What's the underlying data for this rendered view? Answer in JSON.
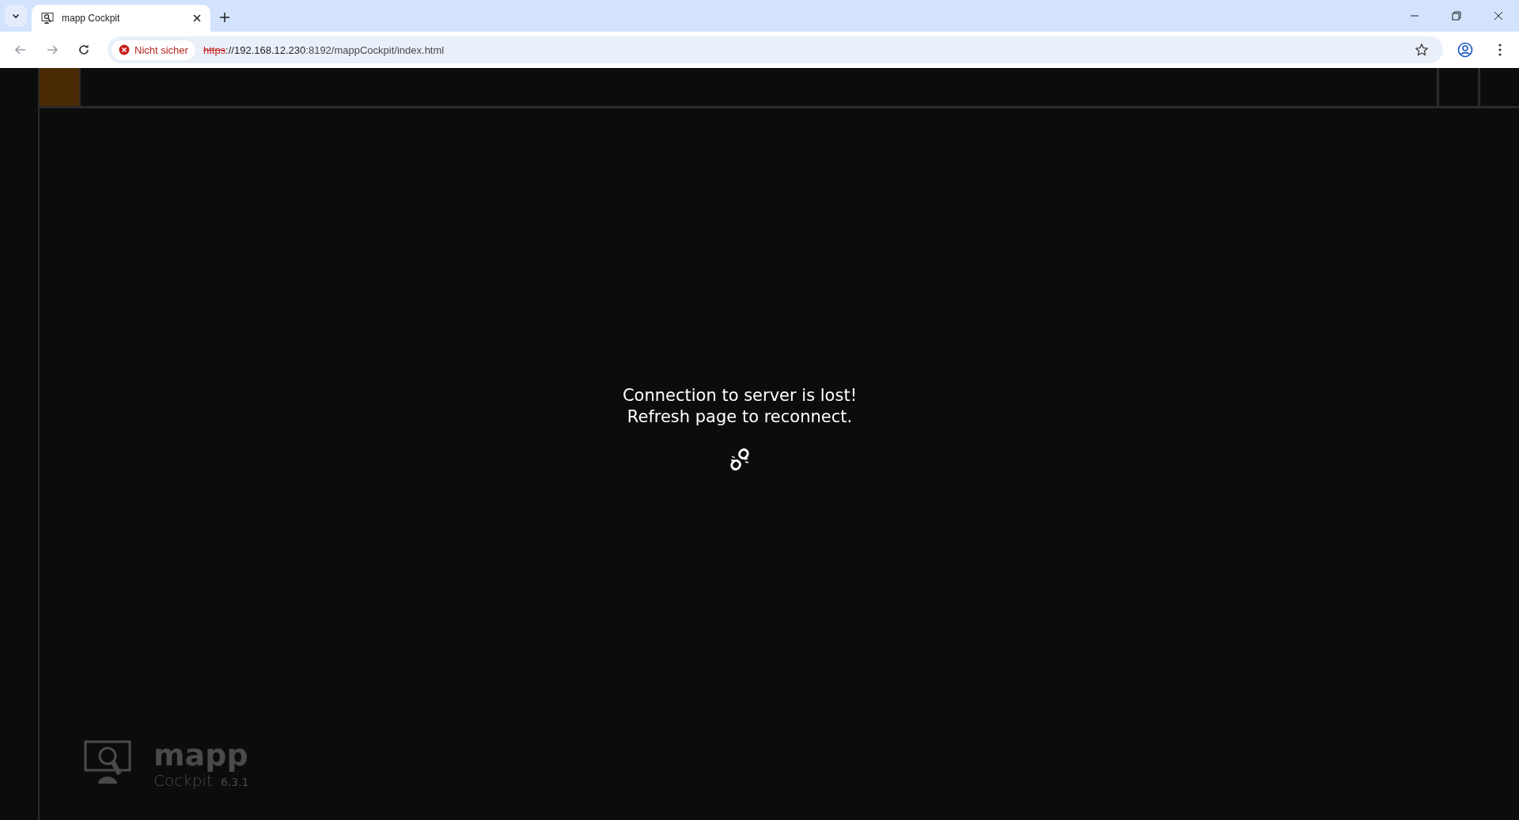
{
  "browser": {
    "tab": {
      "title": "mapp Cockpit",
      "selected": true
    },
    "security_label": "Nicht sicher",
    "url_scheme": "https",
    "url_host": "://192.168.12.230",
    "url_path": ":8192/mappCockpit/index.html"
  },
  "message": {
    "lines": [
      "Connection to server is lost!",
      "Refresh page to reconnect."
    ]
  },
  "logo": {
    "name": "mapp",
    "product": "Cockpit",
    "version": "6.3.1"
  }
}
